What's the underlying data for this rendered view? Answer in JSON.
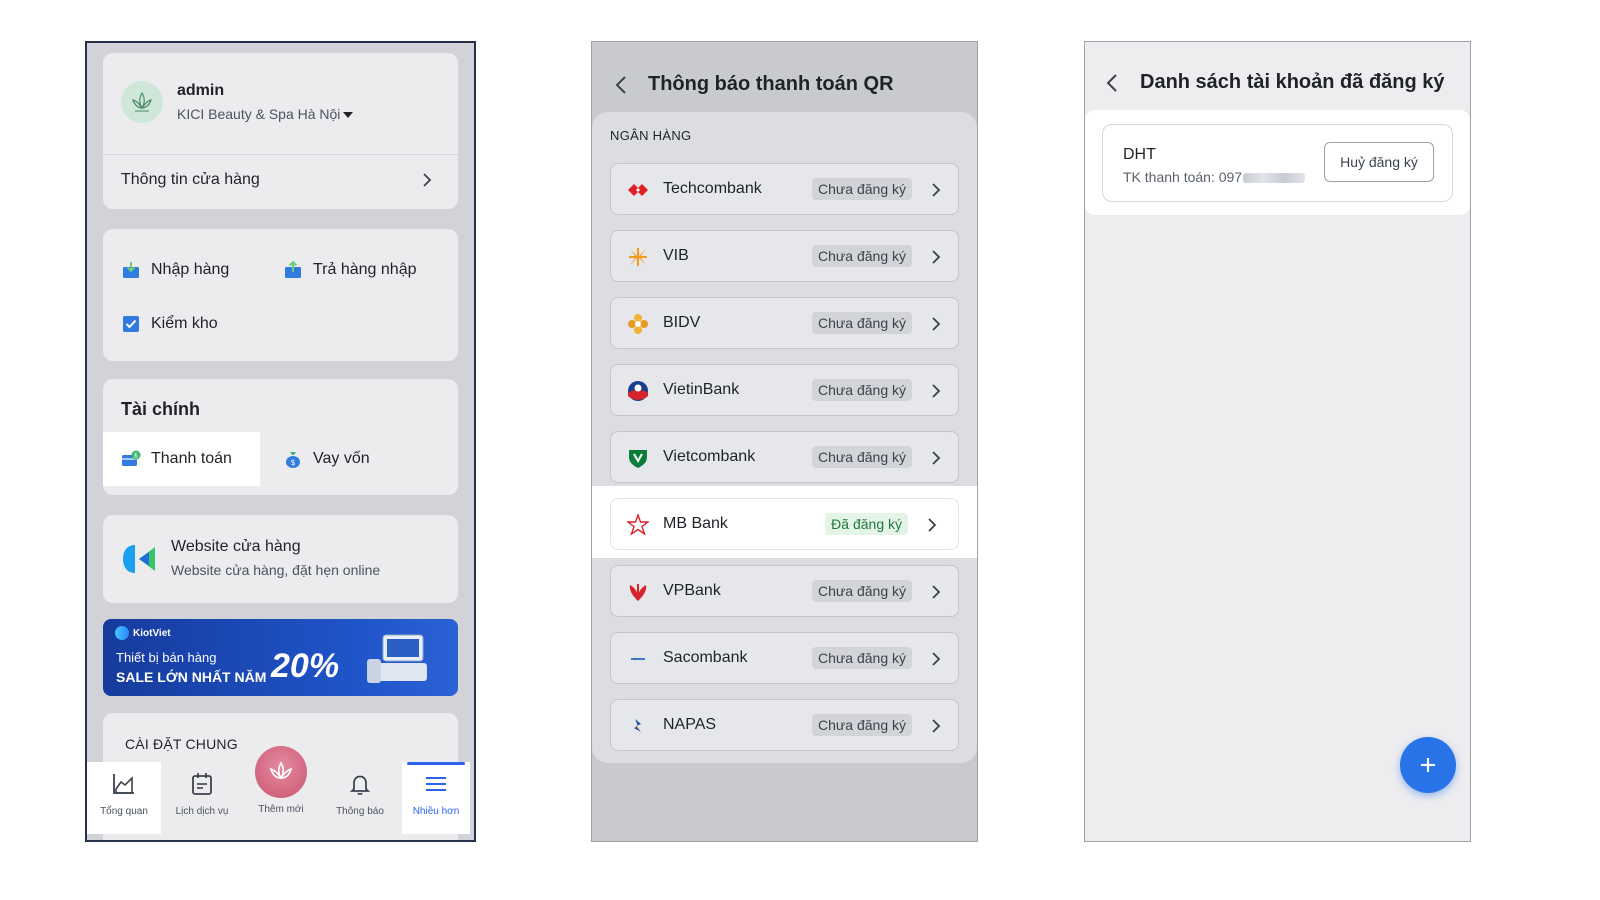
{
  "screen1": {
    "user": {
      "name": "admin",
      "store": "KICI Beauty & Spa Hà Nội"
    },
    "store_info_label": "Thông tin cửa hàng",
    "stock_items": [
      "Nhập hàng",
      "Trả hàng nhập",
      "Kiểm kho"
    ],
    "finance": {
      "title": "Tài chính",
      "items": [
        "Thanh toán",
        "Vay vốn"
      ]
    },
    "website": {
      "title": "Website cửa hàng",
      "subtitle": "Website cửa hàng, đặt hẹn online"
    },
    "banner": {
      "brand": "KiotViet",
      "line1": "Thiết bị bán hàng",
      "line2": "SALE LỚN NHẤT NĂM",
      "percent": "20%"
    },
    "settings_title": "CÀI ĐẶT CHUNG",
    "tabs": [
      "Tổng quan",
      "Lịch dịch vụ",
      "Thêm mới",
      "Thông báo",
      "Nhiều hơn"
    ]
  },
  "screen2": {
    "title": "Thông báo thanh toán QR",
    "section": "NGÂN HÀNG",
    "banks": [
      {
        "name": "Techcombank",
        "status": "Chưa đăng ký"
      },
      {
        "name": "VIB",
        "status": "Chưa đăng ký"
      },
      {
        "name": "BIDV",
        "status": "Chưa đăng ký"
      },
      {
        "name": "VietinBank",
        "status": "Chưa đăng ký"
      },
      {
        "name": "Vietcombank",
        "status": "Chưa đăng ký"
      },
      {
        "name": "MB Bank",
        "status": "Đã đăng ký"
      },
      {
        "name": "VPBank",
        "status": "Chưa đăng ký"
      },
      {
        "name": "Sacombank",
        "status": "Chưa đăng ký"
      },
      {
        "name": "NAPAS",
        "status": "Chưa đăng ký"
      }
    ]
  },
  "screen3": {
    "title": "Danh sách tài khoản đã đăng ký",
    "account": {
      "name": "DHT",
      "number_prefix": "TK thanh toán: 097"
    },
    "unregister_label": "Huỷ đăng ký",
    "fab_label": "+"
  },
  "colors": {
    "accent": "#2864f0",
    "registered": "#1f7a3f",
    "fab": "#2873e8"
  }
}
